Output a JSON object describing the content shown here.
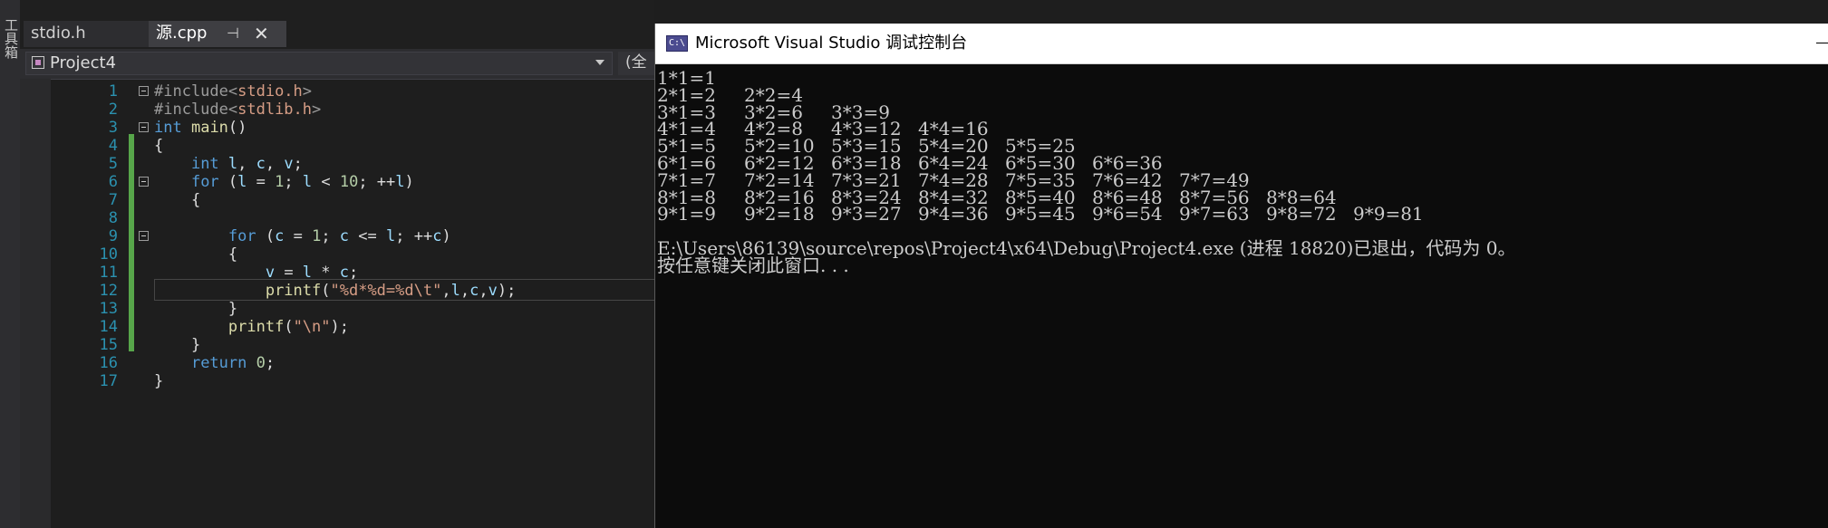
{
  "toolbox_label": "工具箱",
  "tabs": [
    {
      "label": "stdio.h"
    },
    {
      "label": "源.cpp",
      "pin": "⊣",
      "close": "✕"
    }
  ],
  "nav": {
    "scope": "Project4",
    "scope2": "(全"
  },
  "code_lines": [
    {
      "num": "1",
      "html": "<span class=\"p\">#include&lt;</span><span class=\"s\">stdio.h</span><span class=\"p\">&gt;</span>"
    },
    {
      "num": "2",
      "html": "<span class=\"p\">#include&lt;</span><span class=\"s\">stdlib.h</span><span class=\"p\">&gt;</span>"
    },
    {
      "num": "3",
      "html": "<span class=\"k\">int</span> <span class=\"f\">main</span>()"
    },
    {
      "num": "4",
      "html": "{"
    },
    {
      "num": "5",
      "html": "    <span class=\"k\">int</span> <span class=\"v\">l</span>, <span class=\"v\">c</span>, <span class=\"v\">v</span>;"
    },
    {
      "num": "6",
      "html": "    <span class=\"k\">for</span> (<span class=\"v\">l</span> = <span class=\"n\">1</span>; <span class=\"v\">l</span> &lt; <span class=\"n\">10</span>; ++<span class=\"v\">l</span>)"
    },
    {
      "num": "7",
      "html": "    {"
    },
    {
      "num": "8",
      "html": ""
    },
    {
      "num": "9",
      "html": "        <span class=\"k\">for</span> (<span class=\"v\">c</span> = <span class=\"n\">1</span>; <span class=\"v\">c</span> &lt;= <span class=\"v\">l</span>; ++<span class=\"v\">c</span>)"
    },
    {
      "num": "10",
      "html": "        {"
    },
    {
      "num": "11",
      "html": "            <span class=\"v\">v</span> = <span class=\"v\">l</span> * <span class=\"v\">c</span>;"
    },
    {
      "num": "12",
      "html": "            <span class=\"f\">printf</span>(<span class=\"s\">\"%d*%d=%d\\t\"</span>,<span class=\"v\">l</span>,<span class=\"v\">c</span>,<span class=\"v\">v</span>);"
    },
    {
      "num": "13",
      "html": "        }"
    },
    {
      "num": "14",
      "html": "        <span class=\"f\">printf</span>(<span class=\"s\">\"\\n\"</span>);"
    },
    {
      "num": "15",
      "html": "    }"
    },
    {
      "num": "16",
      "html": "    <span class=\"k\">return</span> <span class=\"n\">0</span>;"
    },
    {
      "num": "17",
      "html": "}"
    }
  ],
  "console": {
    "title": "Microsoft Visual Studio 调试控制台",
    "icon_text": "C:\\",
    "table": [
      [
        "1*1=1"
      ],
      [
        "2*1=2",
        "2*2=4"
      ],
      [
        "3*1=3",
        "3*2=6",
        "3*3=9"
      ],
      [
        "4*1=4",
        "4*2=8",
        "4*3=12",
        "4*4=16"
      ],
      [
        "5*1=5",
        "5*2=10",
        "5*3=15",
        "5*4=20",
        "5*5=25"
      ],
      [
        "6*1=6",
        "6*2=12",
        "6*3=18",
        "6*4=24",
        "6*5=30",
        "6*6=36"
      ],
      [
        "7*1=7",
        "7*2=14",
        "7*3=21",
        "7*4=28",
        "7*5=35",
        "7*6=42",
        "7*7=49"
      ],
      [
        "8*1=8",
        "8*2=16",
        "8*3=24",
        "8*4=32",
        "8*5=40",
        "8*6=48",
        "8*7=56",
        "8*8=64"
      ],
      [
        "9*1=9",
        "9*2=18",
        "9*3=27",
        "9*4=36",
        "9*5=45",
        "9*6=54",
        "9*7=63",
        "9*8=72",
        "9*9=81"
      ]
    ],
    "exit_line": "E:\\Users\\86139\\source\\repos\\Project4\\x64\\Debug\\Project4.exe (进程 18820)已退出，代码为 0。",
    "press_key": "按任意键关闭此窗口. . ."
  }
}
